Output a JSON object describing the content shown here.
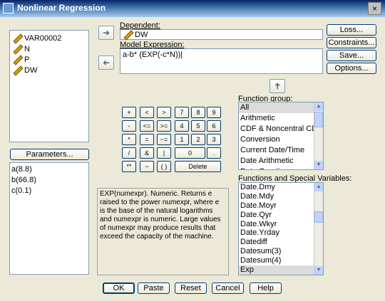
{
  "window": {
    "title": "Nonlinear Regression",
    "close_glyph": "×"
  },
  "variables": [
    "VAR00002",
    "N",
    "P",
    "DW"
  ],
  "dependent": {
    "label": "Dependent:",
    "value": "DW"
  },
  "model": {
    "label": "Model Expression:",
    "value": "a-b* (EXP(-c*N))|"
  },
  "right_buttons": [
    "Loss...",
    "Constraints...",
    "Save...",
    "Options..."
  ],
  "parameters": {
    "button": "Parameters...",
    "items": [
      "a(8.8)",
      "b(66.8)",
      "c(0.1)"
    ]
  },
  "calculator": [
    [
      "+",
      "<",
      ">",
      "7",
      "8",
      "9"
    ],
    [
      "-",
      "<=",
      ">=",
      "4",
      "5",
      "6"
    ],
    [
      "*",
      "=",
      "~=",
      "1",
      "2",
      "3"
    ],
    [
      "/",
      "&",
      "|",
      "0",
      "."
    ],
    [
      "**",
      "~",
      "( )",
      "Delete"
    ]
  ],
  "description": "EXP(numexpr). Numeric. Returns e raised to the power numexpr, where e is the base of the natural logarithms and numexpr is numeric. Large values of numexpr may produce results that exceed the capacity of the machine.",
  "function_group": {
    "label": "Function group:",
    "items": [
      "All",
      "Arithmetic",
      "CDF & Noncentral CDF",
      "Conversion",
      "Current Date/Time",
      "Date Arithmetic",
      "Date Creation"
    ],
    "selected": "All"
  },
  "functions": {
    "label": "Functions and Special Variables:",
    "items": [
      "Date.Dmy",
      "Date.Mdy",
      "Date.Moyr",
      "Date.Qyr",
      "Date.Wkyr",
      "Date.Yrday",
      "Datediff",
      "Datesum(3)",
      "Datesum(4)",
      "Exp"
    ],
    "selected": "Exp"
  },
  "bottom_buttons": [
    "OK",
    "Paste",
    "Reset",
    "Cancel",
    "Help"
  ],
  "icons": {
    "move_right": "arrow-right-icon",
    "move_left": "arrow-left-icon",
    "move_up": "arrow-up-icon"
  }
}
